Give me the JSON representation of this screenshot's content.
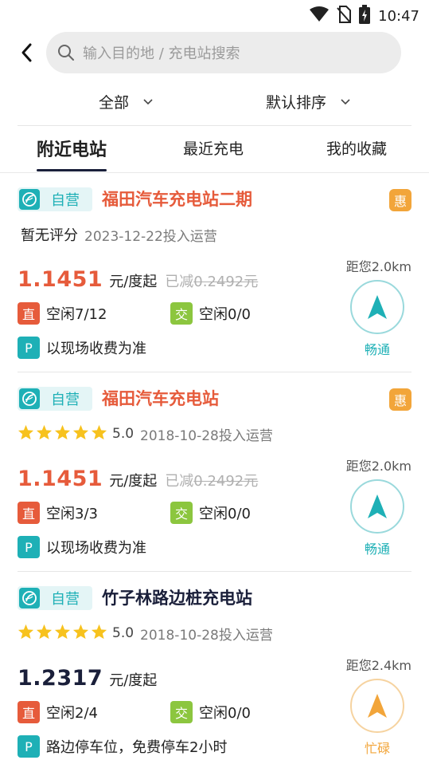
{
  "status_bar": {
    "time": "10:47",
    "icons": [
      "wifi-icon",
      "no-sim-icon",
      "battery-charging-icon"
    ]
  },
  "search": {
    "placeholder": "输入目的地 / 充电站搜索"
  },
  "filters": [
    {
      "label": "全部"
    },
    {
      "label": "默认排序"
    }
  ],
  "tabs": [
    {
      "label": "附近电站",
      "active": true
    },
    {
      "label": "最近充电",
      "active": false
    },
    {
      "label": "我的收藏",
      "active": false
    }
  ],
  "stations": [
    {
      "badge": "自营",
      "name": "福田汽车充电站二期",
      "name_color": "#e65b3b",
      "promo": "惠",
      "rating_text": "暂无评分",
      "stars": 0,
      "score": "",
      "open_date": "2023-12-22投入运营",
      "price": "1.1451",
      "price_color": "#e65b3b",
      "unit": "元/度起",
      "discount_prefix": "已减",
      "discount_amount": "0.2492元",
      "dc_tag": "直",
      "dc_text": "空闲7/12",
      "ac_tag": "交",
      "ac_text": "空闲0/0",
      "park_tag": "P",
      "park_text": "以现场收费为准",
      "distance": "距您2.0km",
      "traffic": "畅通",
      "traffic_color": "#1eb0b6"
    },
    {
      "badge": "自营",
      "name": "福田汽车充电站",
      "name_color": "#e65b3b",
      "promo": "惠",
      "rating_text": "",
      "stars": 5,
      "score": "5.0",
      "open_date": "2018-10-28投入运营",
      "price": "1.1451",
      "price_color": "#e65b3b",
      "unit": "元/度起",
      "discount_prefix": "已减",
      "discount_amount": "0.2492元",
      "dc_tag": "直",
      "dc_text": "空闲3/3",
      "ac_tag": "交",
      "ac_text": "空闲0/0",
      "park_tag": "P",
      "park_text": "以现场收费为准",
      "distance": "距您2.0km",
      "traffic": "畅通",
      "traffic_color": "#1eb0b6"
    },
    {
      "badge": "自营",
      "name": "竹子林路边桩充电站",
      "name_color": "#1a1f3a",
      "promo": "",
      "rating_text": "",
      "stars": 5,
      "score": "5.0",
      "open_date": "2018-10-28投入运营",
      "price": "1.2317",
      "price_color": "#1a1f3a",
      "unit": "元/度起",
      "discount_prefix": "",
      "discount_amount": "",
      "dc_tag": "直",
      "dc_text": "空闲2/4",
      "ac_tag": "交",
      "ac_text": "空闲0/0",
      "park_tag": "P",
      "park_text": "路边停车位，免费停车2小时",
      "distance": "距您2.4km",
      "traffic": "忙碌",
      "traffic_color": "#f2a53a"
    }
  ]
}
